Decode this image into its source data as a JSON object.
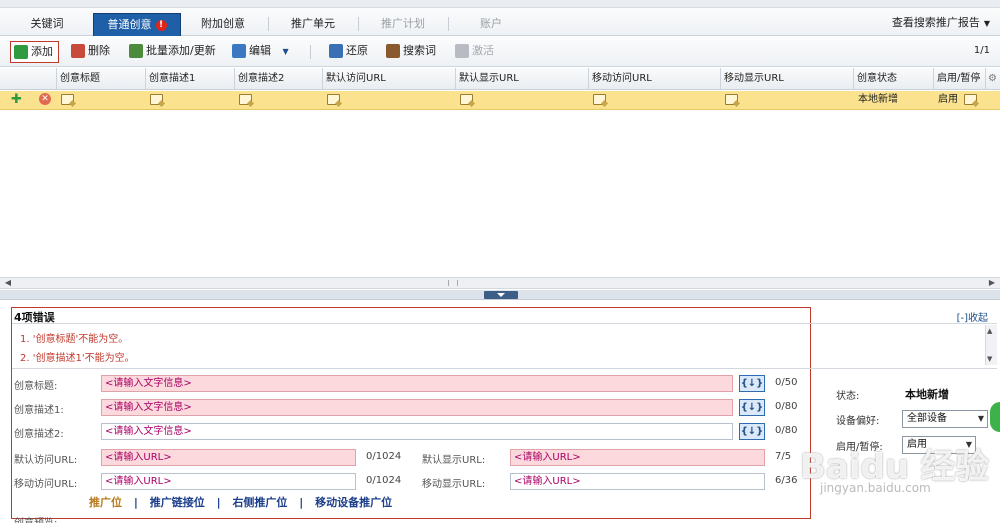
{
  "tabs": [
    {
      "label": "关键词"
    },
    {
      "label": "普通创意",
      "badge": "!"
    },
    {
      "label": "附加创意"
    },
    {
      "label": "推广单元"
    },
    {
      "label": "推广计划"
    },
    {
      "label": "账户"
    }
  ],
  "report_link": "查看搜索推广报告",
  "toolbar": {
    "add": "添加",
    "delete": "删除",
    "batch": "批量添加/更新",
    "edit": "编辑",
    "restore": "还原",
    "search_terms": "搜索词",
    "activate": "激活",
    "pager": "1/1"
  },
  "grid": {
    "columns": [
      "创意标题",
      "创意描述1",
      "创意描述2",
      "默认访问URL",
      "默认显示URL",
      "移动访问URL",
      "移动显示URL",
      "创意状态",
      "启用/暂停"
    ],
    "row": {
      "status": "本地新增",
      "enabled": "启用"
    }
  },
  "errors": {
    "title": "4项错误",
    "collapse": "[-]收起",
    "items": [
      "1. '创意标题'不能为空。",
      "2. '创意描述1'不能为空。"
    ]
  },
  "form": {
    "title_label": "创意标题:",
    "desc1_label": "创意描述1:",
    "desc2_label": "创意描述2:",
    "default_url_label": "默认访问URL:",
    "default_display_label": "默认显示URL:",
    "mobile_url_label": "移动访问URL:",
    "mobile_display_label": "移动显示URL:",
    "text_placeholder": "<请输入文字信息>",
    "url_placeholder": "<请输入URL>",
    "insert_label": "{↓}",
    "title_count": "0/50",
    "desc1_count": "0/80",
    "desc2_count": "0/80",
    "default_url_count": "0/1024",
    "mobile_url_count": "0/1024",
    "mobile_display_count": "6/36",
    "default_display_count": "7/5",
    "cut_label": "创意预览:"
  },
  "positions": [
    "推广位",
    "推广链接位",
    "右侧推广位",
    "移动设备推广位"
  ],
  "position_separator": "|",
  "side": {
    "status_label": "状态:",
    "status_value": "本地新增",
    "device_label": "设备偏好:",
    "device_value": "全部设备",
    "enable_label": "启用/暂停:",
    "enable_value": "启用"
  },
  "watermark": {
    "main": "Baidu 经验",
    "sub": "jingyan.baidu.com"
  },
  "colors": {
    "tab_active": "#1f5fa8",
    "error": "#c0392b",
    "row_highlight": "#fbe28f",
    "required_field": "#fbd9dc"
  }
}
